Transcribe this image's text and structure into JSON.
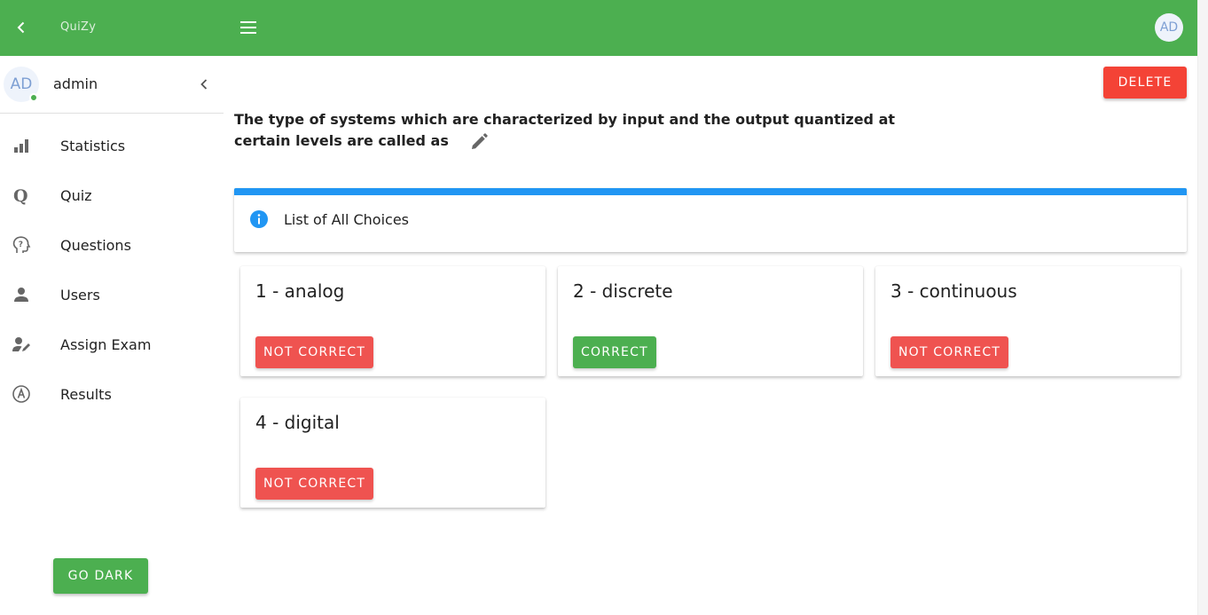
{
  "app": {
    "name": "QuiZy",
    "avatar_initials": "AD"
  },
  "user": {
    "initials": "AD",
    "name": "admin",
    "status_color": "#4caf50"
  },
  "colors": {
    "primary": "#4caf50",
    "danger": "#f44336",
    "info": "#2196f3",
    "avatar_text": "#7d9fd3"
  },
  "sidebar": {
    "items": [
      {
        "label": "Statistics",
        "icon": "bar-chart-icon"
      },
      {
        "label": "Quiz",
        "icon": "quiz-q-icon"
      },
      {
        "label": "Questions",
        "icon": "head-question-icon"
      },
      {
        "label": "Users",
        "icon": "person-icon"
      },
      {
        "label": "Assign Exam",
        "icon": "person-edit-icon"
      },
      {
        "label": "Results",
        "icon": "circle-a-icon"
      }
    ],
    "theme_button": "GO DARK"
  },
  "main": {
    "delete_label": "DELETE",
    "question_text": "The type of systems which are characterized by input and the output quantized at certain levels are called as",
    "choices_header": "List of All Choices",
    "choices": [
      {
        "title": "1 - analog",
        "status": "NOT CORRECT",
        "correct": false
      },
      {
        "title": "2 - discrete",
        "status": "CORRECT",
        "correct": true
      },
      {
        "title": "3 - continuous",
        "status": "NOT CORRECT",
        "correct": false
      },
      {
        "title": "4 - digital",
        "status": "NOT CORRECT",
        "correct": false
      }
    ]
  }
}
